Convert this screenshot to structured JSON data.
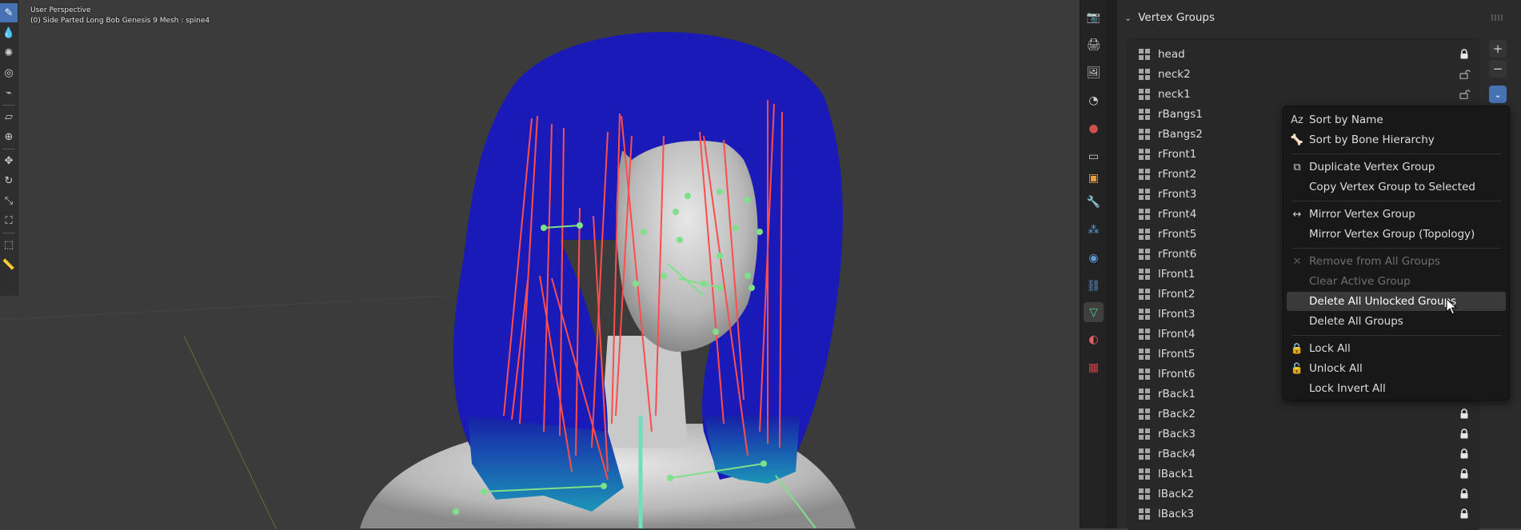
{
  "viewport": {
    "perspective_label": "User Perspective",
    "object_label": "(0) Side Parted Long Bob Genesis 9 Mesh : spine4"
  },
  "toolbar": {
    "tools": [
      {
        "icon": "annotate-brush-icon",
        "glyph": "✎",
        "active": true
      },
      {
        "icon": "blur-drop-icon",
        "glyph": "💧",
        "active": false
      },
      {
        "icon": "smear-icon",
        "glyph": "✺",
        "active": false
      },
      {
        "icon": "clone-icon",
        "glyph": "◎",
        "active": false
      },
      {
        "icon": "eyedropper-icon",
        "glyph": "⌁",
        "active": false
      },
      {
        "icon": "gradient-icon",
        "glyph": "▱",
        "active": false
      },
      {
        "icon": "cursor-icon",
        "glyph": "⊕",
        "active": false
      },
      {
        "icon": "move-icon",
        "glyph": "✥",
        "active": false
      },
      {
        "icon": "rotate-icon",
        "glyph": "↻",
        "active": false
      },
      {
        "icon": "scale-icon",
        "glyph": "⤡",
        "active": false
      },
      {
        "icon": "transform-icon",
        "glyph": "⛶",
        "active": false
      },
      {
        "icon": "select-box-icon",
        "glyph": "⬚",
        "active": false
      },
      {
        "icon": "measure-icon",
        "glyph": "📏",
        "active": false
      }
    ]
  },
  "property_tabs": [
    {
      "icon": "render-icon",
      "glyph": "📷",
      "color": "#cfcfcf"
    },
    {
      "icon": "output-icon",
      "glyph": "🖨",
      "color": "#cfcfcf"
    },
    {
      "icon": "view-layer-icon",
      "glyph": "🖼",
      "color": "#cfcfcf"
    },
    {
      "icon": "scene-icon",
      "glyph": "◔",
      "color": "#cfcfcf"
    },
    {
      "icon": "world-icon",
      "glyph": "●",
      "color": "#d0504a"
    },
    {
      "icon": "collection-icon",
      "glyph": "▭",
      "color": "#cfcfcf"
    },
    {
      "icon": "object-icon",
      "glyph": "▣",
      "color": "#f29c38"
    },
    {
      "icon": "modifiers-icon",
      "glyph": "🔧",
      "color": "#5a9bd8"
    },
    {
      "icon": "particles-icon",
      "glyph": "⁂",
      "color": "#5a9bd8"
    },
    {
      "icon": "physics-icon",
      "glyph": "◉",
      "color": "#5a9bd8"
    },
    {
      "icon": "constraints-icon",
      "glyph": "⛓",
      "color": "#5a9bd8"
    },
    {
      "icon": "object-data-icon",
      "glyph": "▽",
      "color": "#4fd08a",
      "active": true
    },
    {
      "icon": "material-icon",
      "glyph": "◐",
      "color": "#e06060"
    },
    {
      "icon": "texture-icon",
      "glyph": "▦",
      "color": "#d04040"
    }
  ],
  "vertex_groups": {
    "title": "Vertex Groups",
    "items": [
      {
        "name": "head",
        "locked": true
      },
      {
        "name": "neck2",
        "locked": false
      },
      {
        "name": "neck1",
        "locked": false
      },
      {
        "name": "rBangs1",
        "locked": false
      },
      {
        "name": "rBangs2",
        "locked": false
      },
      {
        "name": "rFront1",
        "locked": false
      },
      {
        "name": "rFront2",
        "locked": false
      },
      {
        "name": "rFront3",
        "locked": false
      },
      {
        "name": "rFront4",
        "locked": false
      },
      {
        "name": "rFront5",
        "locked": false
      },
      {
        "name": "rFront6",
        "locked": false
      },
      {
        "name": "lFront1",
        "locked": false
      },
      {
        "name": "lFront2",
        "locked": false
      },
      {
        "name": "lFront3",
        "locked": false
      },
      {
        "name": "lFront4",
        "locked": false
      },
      {
        "name": "lFront5",
        "locked": false
      },
      {
        "name": "lFront6",
        "locked": false
      },
      {
        "name": "rBack1",
        "locked": false
      },
      {
        "name": "rBack2",
        "locked": true
      },
      {
        "name": "rBack3",
        "locked": true
      },
      {
        "name": "rBack4",
        "locked": true
      },
      {
        "name": "lBack1",
        "locked": true
      },
      {
        "name": "lBack2",
        "locked": true
      },
      {
        "name": "lBack3",
        "locked": true
      }
    ],
    "buttons": {
      "add": "+",
      "remove": "−",
      "specials": "⌄"
    }
  },
  "menu": {
    "items": [
      {
        "label": "Sort by Name",
        "icon": "sort-alpha-icon",
        "glyph": "Aᴢ",
        "disabled": false,
        "hover": false
      },
      {
        "label": "Sort by Bone Hierarchy",
        "icon": "bone-icon",
        "glyph": "🦴",
        "disabled": false,
        "hover": false
      },
      {
        "sep": true
      },
      {
        "label": "Duplicate Vertex Group",
        "icon": "duplicate-icon",
        "glyph": "⧉",
        "disabled": false,
        "hover": false
      },
      {
        "label": "Copy Vertex Group to Selected",
        "icon": "",
        "glyph": "",
        "disabled": false,
        "hover": false
      },
      {
        "sep": true
      },
      {
        "label": "Mirror Vertex Group",
        "icon": "mirror-icon",
        "glyph": "↔",
        "disabled": false,
        "hover": false
      },
      {
        "label": "Mirror Vertex Group (Topology)",
        "icon": "",
        "glyph": "",
        "disabled": false,
        "hover": false
      },
      {
        "sep": true
      },
      {
        "label": "Remove from All Groups",
        "icon": "x-icon",
        "glyph": "✕",
        "disabled": true,
        "hover": false
      },
      {
        "label": "Clear Active Group",
        "icon": "",
        "glyph": "",
        "disabled": true,
        "hover": false
      },
      {
        "label": "Delete All Unlocked Groups",
        "icon": "",
        "glyph": "",
        "disabled": false,
        "hover": true
      },
      {
        "label": "Delete All Groups",
        "icon": "",
        "glyph": "",
        "disabled": false,
        "hover": false
      },
      {
        "sep": true
      },
      {
        "label": "Lock All",
        "icon": "lock-icon",
        "glyph": "🔒",
        "disabled": false,
        "hover": false
      },
      {
        "label": "Unlock All",
        "icon": "unlock-icon",
        "glyph": "🔓",
        "disabled": false,
        "hover": false
      },
      {
        "label": "Lock Invert All",
        "icon": "",
        "glyph": "",
        "disabled": false,
        "hover": false
      }
    ]
  },
  "colors": {
    "accent": "#4772b3",
    "bone": "#ff4d4d",
    "bone_joint": "#7fe08a",
    "hair": "#1a1ab8",
    "hair_tips": "#1d8fb0"
  }
}
